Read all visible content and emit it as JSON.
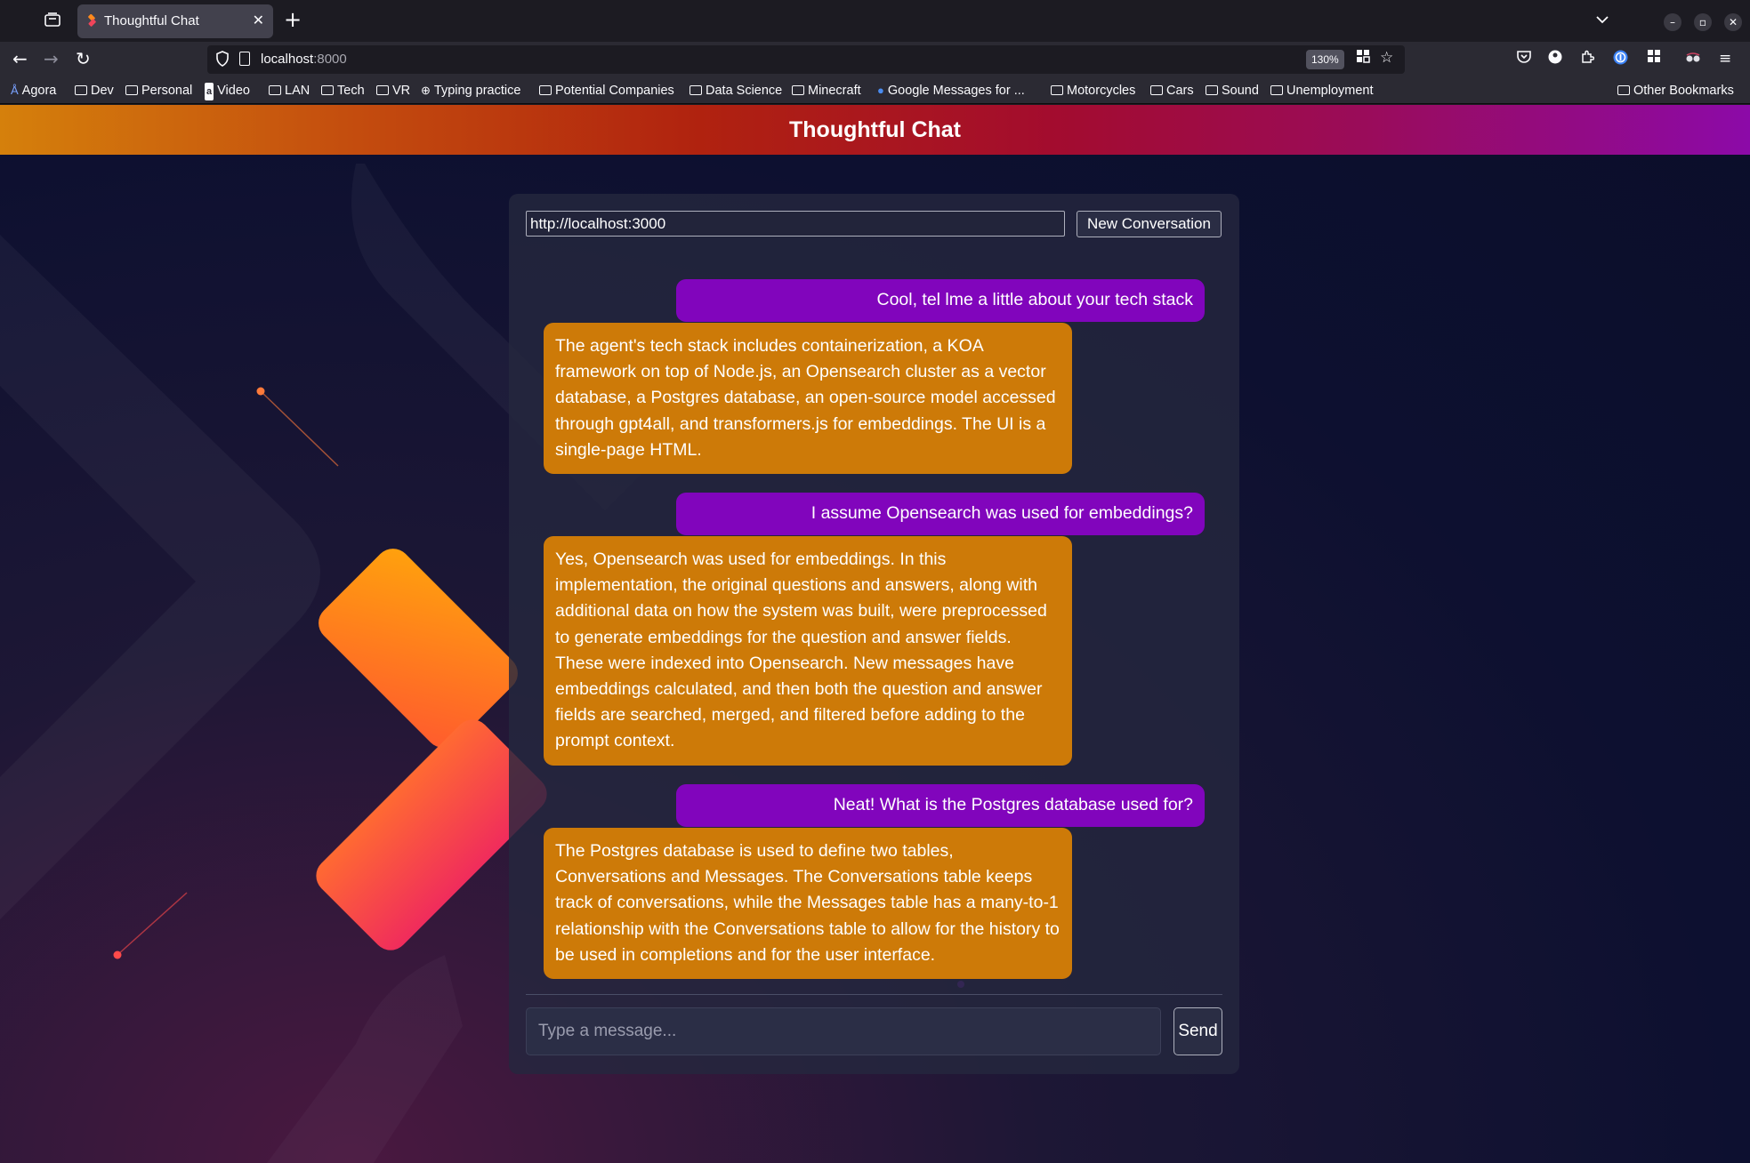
{
  "browser": {
    "tab_title": "Thoughtful Chat",
    "tab_close": "✕",
    "new_tab": "+",
    "url_host": "localhost",
    "url_port": ":8000",
    "zoom": "130%",
    "bookmarks": [
      "Agora",
      "Dev",
      "Personal",
      "Video",
      "LAN",
      "Tech",
      "VR",
      "Typing practice",
      "Potential Companies",
      "Data Science",
      "Minecraft",
      "Google Messages for ...",
      "Motorcycles",
      "Cars",
      "Sound",
      "Unemployment"
    ],
    "other_bookmarks": "Other Bookmarks"
  },
  "app": {
    "title": "Thoughtful Chat",
    "server_url": "http://localhost:3000",
    "new_conversation_label": "New Conversation",
    "input_placeholder": "Type a message...",
    "send_label": "Send"
  },
  "messages": [
    {
      "role": "user",
      "text": "Cool, tel lme a little about your tech stack"
    },
    {
      "role": "bot",
      "text": "The agent's tech stack includes containerization, a KOA framework on top of Node.js, an Opensearch cluster as a vector database, a Postgres database, an open-source model accessed through gpt4all, and transformers.js for embeddings. The UI is a single-page HTML."
    },
    {
      "role": "user",
      "text": "I assume Opensearch was used for embeddings?"
    },
    {
      "role": "bot",
      "text": "Yes, Opensearch was used for embeddings. In this implementation, the original questions and answers, along with additional data on how the system was built, were preprocessed to generate embeddings for the question and answer fields. These were indexed into Opensearch. New messages have embeddings calculated, and then both the question and answer fields are searched, merged, and filtered before adding to the prompt context."
    },
    {
      "role": "user",
      "text": "Neat! What is the Postgres database used for?"
    },
    {
      "role": "bot",
      "text": "The Postgres database is used to define two tables, Conversations and Messages. The Conversations table keeps track of conversations, while the Messages table has a many-to-1 relationship with the Conversations table to allow for the history to be used in completions and for the user interface."
    }
  ],
  "colors": {
    "user_bubble": "#8105bc",
    "bot_bubble": "#cd7a08",
    "header_gradient_start": "#d5800c",
    "header_gradient_end": "#8c0aa8"
  }
}
